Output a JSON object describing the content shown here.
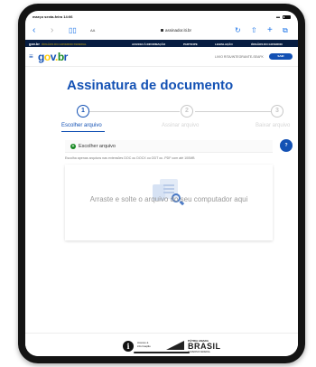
{
  "status_bar": {
    "time": "março sexta-feira 14:06"
  },
  "browser": {
    "url": "assinador.iti.br",
    "text_size_label": "AA",
    "icons": [
      "back-icon",
      "forward-icon",
      "bookmarks-icon",
      "lock-icon",
      "reload-icon",
      "share-icon",
      "new-tab-icon",
      "tabs-icon"
    ]
  },
  "gov_bar": {
    "brand": "gov.br",
    "red_text": "ÓRGÃOS DO GOVERNO FEDERAL",
    "links": [
      "ACESSO À INFORMAÇÃO",
      "PARTICIPE",
      "LEGISLAÇÃO",
      "ÓRGÃOS DO GOVERNO"
    ]
  },
  "header": {
    "logo": {
      "g": "g",
      "o": "o",
      "v": "v",
      "dot": ".",
      "b": "b",
      "r": "r"
    },
    "user_label": "LIVIO RITA/INTEGRANTE-SEAFK",
    "enter_label": "SAIR"
  },
  "page": {
    "title": "Assinatura de documento",
    "steps": [
      {
        "number": "1",
        "label": "Escolher arquivo",
        "state": "active"
      },
      {
        "number": "2",
        "label": "Assinar arquivo",
        "state": "idle"
      },
      {
        "number": "3",
        "label": "Baixar arquivo",
        "state": "idle"
      }
    ],
    "choose_button": "Escolher arquivo",
    "help_label": "?",
    "hint": "Escolha apenas arquivos nas extensões DOC ou DOCX ou ODT ou .PDF com até 100MB",
    "drop_text": "Arraste e solte o arquivo do seu computador aqui"
  },
  "footer": {
    "access_info": "Acesso à informação",
    "brasil_small": "PÁTRIA AMADA",
    "brasil_big": "BRASIL",
    "brasil_gov": "GOVERNO FEDERAL"
  },
  "colors": {
    "primary": "#1351b4",
    "dark_navy": "#071d41",
    "green": "#168821",
    "yellow": "#ffcd07"
  }
}
